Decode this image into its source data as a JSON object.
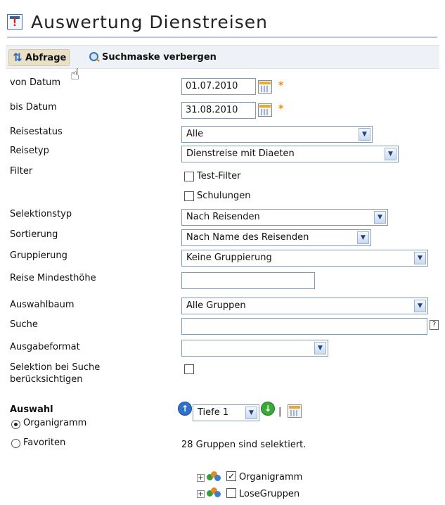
{
  "header": {
    "title": "Auswertung Dienstreisen",
    "title_icon": "report-icon"
  },
  "toolbar": {
    "query_label": "Abfrage",
    "hide_search_label": "Suchmaske verbergen"
  },
  "form": {
    "from_date": {
      "label": "von Datum",
      "value": "01.07.2010",
      "required_mark": "*"
    },
    "to_date": {
      "label": "bis Datum",
      "value": "31.08.2010",
      "required_mark": "*"
    },
    "travel_status": {
      "label": "Reisestatus",
      "value": "Alle"
    },
    "travel_type": {
      "label": "Reisetyp",
      "value": "Dienstreise mit Diaeten"
    },
    "filter": {
      "label": "Filter",
      "options": [
        {
          "label": "Test-Filter",
          "checked": false
        },
        {
          "label": "Schulungen",
          "checked": false
        }
      ]
    },
    "selection_type": {
      "label": "Selektionstyp",
      "value": "Nach Reisenden"
    },
    "sorting": {
      "label": "Sortierung",
      "value": "Nach Name des Reisenden"
    },
    "grouping": {
      "label": "Gruppierung",
      "value": "Keine Gruppierung"
    },
    "min_amount": {
      "label": "Reise Mindesthöhe",
      "value": ""
    },
    "selection_tree": {
      "label": "Auswahlbaum",
      "value": "Alle Gruppen"
    },
    "search": {
      "label": "Suche",
      "value": "",
      "help": "?"
    },
    "output_format": {
      "label": "Ausgabeformat",
      "value": ""
    },
    "consider_selection": {
      "label_line1": "Selektion bei Suche",
      "label_line2": "berücksichtigen",
      "checked": false
    }
  },
  "selection": {
    "title": "Auswahl",
    "options": [
      {
        "label": "Organigramm",
        "selected": true
      },
      {
        "label": "Favoriten",
        "selected": false
      }
    ],
    "depth": "Tiefe 1",
    "separator": "|",
    "status_text": "28 Gruppen sind selektiert.",
    "tree": [
      {
        "label": "Organigramm",
        "checked": true
      },
      {
        "label": "LoseGruppen",
        "checked": false
      }
    ]
  },
  "colors": {
    "accent": "#2f73c9",
    "required": "#f08a00",
    "toolbar_bg": "#eef1f5"
  }
}
